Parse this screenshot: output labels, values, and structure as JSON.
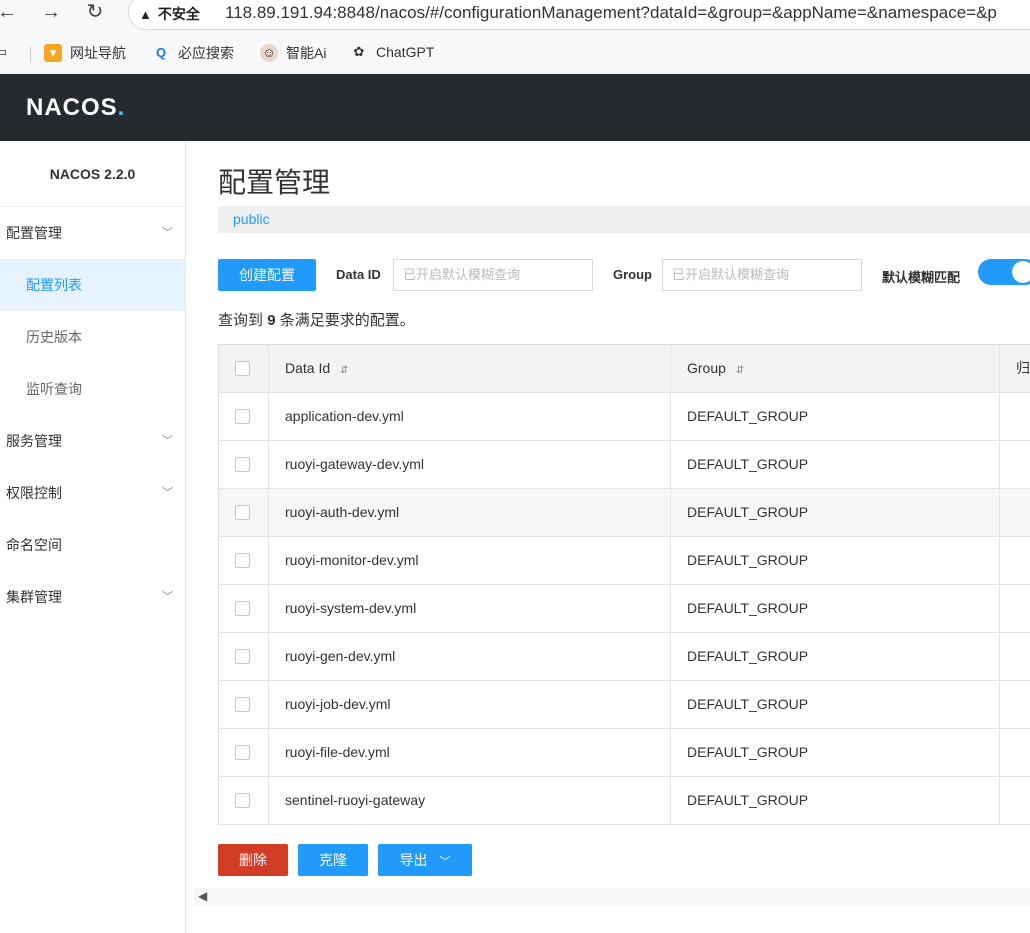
{
  "browser": {
    "security_label": "不安全",
    "url": "118.89.191.94:8848/nacos/#/configurationManagement?dataId=&group=&appName=&namespace=&p",
    "bookmarks": [
      {
        "label": "网址导航",
        "icon": "nav-icon"
      },
      {
        "label": "必应搜索",
        "icon": "search-icon"
      },
      {
        "label": "智能Ai",
        "icon": "avatar-icon"
      },
      {
        "label": "ChatGPT",
        "icon": "chatgpt-icon"
      }
    ]
  },
  "header": {
    "logo": "NACOS"
  },
  "sidebar": {
    "version": "NACOS 2.2.0",
    "items": [
      {
        "label": "配置管理",
        "expandable": true
      },
      {
        "label": "配置列表",
        "sub": true,
        "active": true
      },
      {
        "label": "历史版本",
        "sub": true
      },
      {
        "label": "监听查询",
        "sub": true
      },
      {
        "label": "服务管理",
        "expandable": true
      },
      {
        "label": "权限控制",
        "expandable": true
      },
      {
        "label": "命名空间",
        "expandable": false
      },
      {
        "label": "集群管理",
        "expandable": true
      }
    ]
  },
  "main": {
    "title": "配置管理",
    "namespace": "public",
    "create_button": "创建配置",
    "data_id_label": "Data ID",
    "data_id_placeholder": "已开启默认模糊查询",
    "group_label": "Group",
    "group_placeholder": "已开启默认模糊查询",
    "fuzzy_label": "默认模糊匹配",
    "fuzzy_enabled": true,
    "result_prefix": "查询到",
    "result_count": "9",
    "result_suffix": "条满足要求的配置。",
    "table": {
      "headers": {
        "data_id": "Data Id",
        "group": "Group",
        "ns": "归"
      },
      "rows": [
        {
          "data_id": "application-dev.yml",
          "group": "DEFAULT_GROUP"
        },
        {
          "data_id": "ruoyi-gateway-dev.yml",
          "group": "DEFAULT_GROUP"
        },
        {
          "data_id": "ruoyi-auth-dev.yml",
          "group": "DEFAULT_GROUP"
        },
        {
          "data_id": "ruoyi-monitor-dev.yml",
          "group": "DEFAULT_GROUP"
        },
        {
          "data_id": "ruoyi-system-dev.yml",
          "group": "DEFAULT_GROUP"
        },
        {
          "data_id": "ruoyi-gen-dev.yml",
          "group": "DEFAULT_GROUP"
        },
        {
          "data_id": "ruoyi-job-dev.yml",
          "group": "DEFAULT_GROUP"
        },
        {
          "data_id": "ruoyi-file-dev.yml",
          "group": "DEFAULT_GROUP"
        },
        {
          "data_id": "sentinel-ruoyi-gateway",
          "group": "DEFAULT_GROUP"
        }
      ]
    },
    "delete_button": "删除",
    "clone_button": "克隆",
    "export_button": "导出"
  },
  "colors": {
    "primary": "#209bfa",
    "danger": "#d23c26",
    "header_bg": "#252a2f"
  }
}
